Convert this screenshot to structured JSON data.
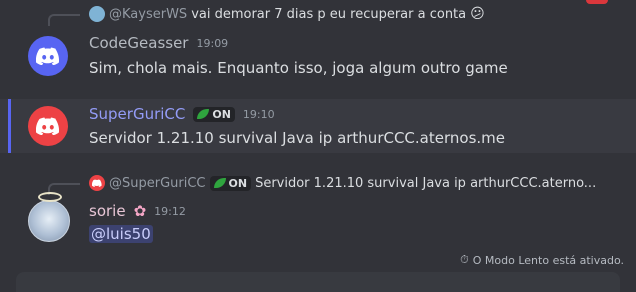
{
  "messages": [
    {
      "reply": {
        "author": "@KayserWS",
        "text": "vai demorar 7 dias p eu recuperar a conta",
        "emoji": "😕"
      },
      "author": "CodeGeasser",
      "time": "19:09",
      "content": "Sim, chola mais. Enquanto isso, joga algum outro game"
    },
    {
      "author": "SuperGuriCC",
      "badge": "ON",
      "time": "19:10",
      "content": "Servidor 1.21.10 survival Java ip arthurCCC.aternos.me"
    },
    {
      "reply": {
        "author": "@SuperGuriCC",
        "badge": "ON",
        "text": "Servidor 1.21.10 survival Java ip arthurCCC.aterno..."
      },
      "author": "sorie",
      "time": "19:12",
      "content": "@luis50"
    }
  ],
  "footer": {
    "slowmode": "O Modo Lento está ativado."
  },
  "colors": {
    "background": "#323339",
    "accent": "#5865f2",
    "supergurimention": "#e57a9a"
  }
}
